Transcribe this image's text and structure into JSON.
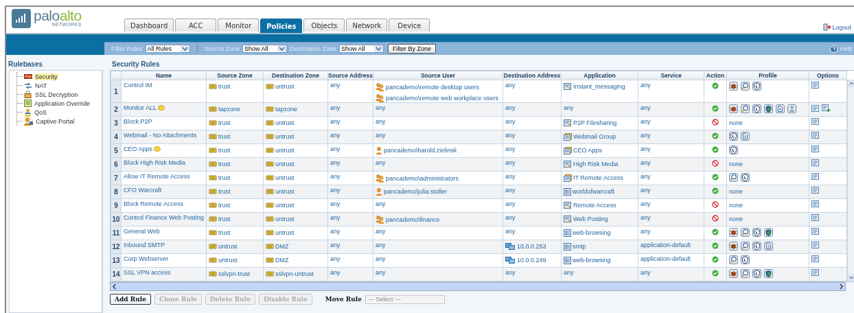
{
  "logo": {
    "name_parts": [
      "palo",
      "alto"
    ],
    "tagline": "NETWORKS"
  },
  "tabs": [
    {
      "label": "Dashboard",
      "selected": false
    },
    {
      "label": "ACC",
      "selected": false
    },
    {
      "label": "Monitor",
      "selected": false
    },
    {
      "label": "Policies",
      "selected": true
    },
    {
      "label": "Objects",
      "selected": false
    },
    {
      "label": "Network",
      "selected": false
    },
    {
      "label": "Device",
      "selected": false
    }
  ],
  "logout": "Logout",
  "filter_bar": {
    "filter_rules_label": "Filter Rules",
    "filter_rules_value": "All Rules",
    "source_zone_label": "Source Zone",
    "source_zone_value": "Show All",
    "destination_zone_label": "Destination Zone",
    "destination_zone_value": "Show All",
    "filter_button": "Filter By Zone",
    "help": "Help"
  },
  "sidebar": {
    "title": "Rulebases",
    "items": [
      {
        "label": "Security",
        "kind": "security",
        "selected": true
      },
      {
        "label": "NAT",
        "kind": "nat",
        "selected": false
      },
      {
        "label": "SSL Decryption",
        "kind": "ssl",
        "selected": false
      },
      {
        "label": "Application Override",
        "kind": "override",
        "selected": false
      },
      {
        "label": "QoS",
        "kind": "qos",
        "selected": false
      },
      {
        "label": "Captive Portal",
        "kind": "portal",
        "selected": false
      }
    ]
  },
  "table": {
    "title": "Security Rules",
    "columns": [
      "Name",
      "Source Zone",
      "Destination Zone",
      "Source Address",
      "Source User",
      "Destination Address",
      "Application",
      "Service",
      "Action",
      "Profile",
      "Options"
    ],
    "rows": [
      {
        "number": "1",
        "name": "Control IM",
        "note": false,
        "source_zone": "trust",
        "destination_zone": "untrust",
        "source_address": "any",
        "source_user": [
          {
            "text": "pancademo\\remote desktop users",
            "kind": "group"
          },
          {
            "text": "pancademo\\remote web workplace users",
            "kind": "group"
          }
        ],
        "destination_address": {
          "text": "any",
          "kind": "plain"
        },
        "application": {
          "text": "Instant_messaging",
          "kind": "filter"
        },
        "service": "any",
        "action": {
          "kind": "allow"
        },
        "profiles": [
          {
            "kind": "antivirus"
          },
          {
            "kind": "vulnerability"
          },
          {
            "kind": "spyware"
          }
        ],
        "options": [
          {
            "kind": "log"
          }
        ]
      },
      {
        "number": "2",
        "name": "Monitor ALL",
        "note": true,
        "source_zone": "tapzone",
        "destination_zone": "tapzone",
        "source_address": "any",
        "source_user": [
          {
            "text": "any",
            "kind": "plain"
          }
        ],
        "destination_address": {
          "text": "any",
          "kind": "plain"
        },
        "application": {
          "text": "any",
          "kind": "plain"
        },
        "service": "any",
        "action": {
          "kind": "allow"
        },
        "profiles": [
          {
            "kind": "antivirus"
          },
          {
            "kind": "vulnerability"
          },
          {
            "kind": "spyware"
          },
          {
            "kind": "url"
          },
          {
            "kind": "file"
          },
          {
            "kind": "data"
          }
        ],
        "options": [
          {
            "kind": "log"
          },
          {
            "kind": "schedule"
          }
        ]
      },
      {
        "number": "3",
        "name": "Block P2P",
        "note": false,
        "source_zone": "trust",
        "destination_zone": "untrust",
        "source_address": "any",
        "source_user": [
          {
            "text": "any",
            "kind": "plain"
          }
        ],
        "destination_address": {
          "text": "any",
          "kind": "plain"
        },
        "application": {
          "text": "P2P Filesharing",
          "kind": "filter"
        },
        "service": "any",
        "action": {
          "kind": "deny"
        },
        "profile_text": "none",
        "options": [
          {
            "kind": "log"
          }
        ]
      },
      {
        "number": "4",
        "name": "Webmail - No Attachments",
        "note": false,
        "source_zone": "trust",
        "destination_zone": "untrust",
        "source_address": "any",
        "source_user": [
          {
            "text": "any",
            "kind": "plain"
          }
        ],
        "destination_address": {
          "text": "any",
          "kind": "plain"
        },
        "application": {
          "text": "Webmail Group",
          "kind": "group"
        },
        "service": "any",
        "action": {
          "kind": "allow"
        },
        "profiles": [
          {
            "kind": "spyware"
          },
          {
            "kind": "file"
          }
        ],
        "options": [
          {
            "kind": "log"
          }
        ]
      },
      {
        "number": "5",
        "name": "CEO Apps",
        "note": true,
        "source_zone": "trust",
        "destination_zone": "untrust",
        "source_address": "any",
        "source_user": [
          {
            "text": "pancademo\\harold.zielinsk",
            "kind": "user"
          }
        ],
        "destination_address": {
          "text": "any",
          "kind": "plain"
        },
        "application": {
          "text": "CEO Apps",
          "kind": "group"
        },
        "service": "any",
        "action": {
          "kind": "allow"
        },
        "profiles": [
          {
            "kind": "spyware"
          }
        ],
        "options": [
          {
            "kind": "log"
          }
        ]
      },
      {
        "number": "6",
        "name": "Block High Risk Media",
        "note": false,
        "source_zone": "trust",
        "destination_zone": "untrust",
        "source_address": "any",
        "source_user": [
          {
            "text": "any",
            "kind": "plain"
          }
        ],
        "destination_address": {
          "text": "any",
          "kind": "plain"
        },
        "application": {
          "text": "High Risk Media",
          "kind": "filter"
        },
        "service": "any",
        "action": {
          "kind": "deny"
        },
        "profile_text": "none",
        "options": [
          {
            "kind": "log"
          }
        ]
      },
      {
        "number": "7",
        "name": "Allow IT Remote Access",
        "note": false,
        "source_zone": "trust",
        "destination_zone": "untrust",
        "source_address": "any",
        "source_user": [
          {
            "text": "pancademo\\administrators",
            "kind": "group"
          }
        ],
        "destination_address": {
          "text": "any",
          "kind": "plain"
        },
        "application": {
          "text": "IT Remote Access",
          "kind": "group"
        },
        "service": "any",
        "action": {
          "kind": "allow"
        },
        "profiles": [
          {
            "kind": "vulnerability"
          },
          {
            "kind": "spyware"
          }
        ],
        "options": [
          {
            "kind": "log"
          }
        ]
      },
      {
        "number": "8",
        "name": "CFO Warcraft",
        "note": false,
        "source_zone": "trust",
        "destination_zone": "untrust",
        "source_address": "any",
        "source_user": [
          {
            "text": "pancademo\\julia.stoller",
            "kind": "user"
          }
        ],
        "destination_address": {
          "text": "any",
          "kind": "plain"
        },
        "application": {
          "text": "worldofwarcraft",
          "kind": "app"
        },
        "service": "any",
        "action": {
          "kind": "allow"
        },
        "profile_text": "none",
        "options": [
          {
            "kind": "log"
          }
        ]
      },
      {
        "number": "9",
        "name": "Block Remote Access",
        "note": false,
        "source_zone": "trust",
        "destination_zone": "untrust",
        "source_address": "any",
        "source_user": [
          {
            "text": "any",
            "kind": "plain"
          }
        ],
        "destination_address": {
          "text": "any",
          "kind": "plain"
        },
        "application": {
          "text": "Remote Access",
          "kind": "filter"
        },
        "service": "any",
        "action": {
          "kind": "deny"
        },
        "profile_text": "none",
        "options": [
          {
            "kind": "log"
          }
        ]
      },
      {
        "number": "10",
        "name": "Control Finance Web Posting",
        "note": false,
        "source_zone": "trust",
        "destination_zone": "untrust",
        "source_address": "any",
        "source_user": [
          {
            "text": "pancademo\\finance",
            "kind": "group"
          }
        ],
        "destination_address": {
          "text": "any",
          "kind": "plain"
        },
        "application": {
          "text": "Web Posting",
          "kind": "filter"
        },
        "service": "any",
        "action": {
          "kind": "deny"
        },
        "profile_text": "none",
        "options": [
          {
            "kind": "log"
          }
        ]
      },
      {
        "number": "11",
        "name": "General Web",
        "note": false,
        "source_zone": "trust",
        "destination_zone": "untrust",
        "source_address": "any",
        "source_user": [
          {
            "text": "any",
            "kind": "plain"
          }
        ],
        "destination_address": {
          "text": "any",
          "kind": "plain"
        },
        "application": {
          "text": "web-browsing",
          "kind": "app"
        },
        "service": "any",
        "action": {
          "kind": "allow"
        },
        "profiles": [
          {
            "kind": "antivirus"
          },
          {
            "kind": "vulnerability"
          },
          {
            "kind": "spyware"
          },
          {
            "kind": "url"
          }
        ],
        "options": [
          {
            "kind": "log"
          }
        ]
      },
      {
        "number": "12",
        "name": "Inbound SMTP",
        "note": false,
        "source_zone": "untrust",
        "destination_zone": "DMZ",
        "source_address": "any",
        "source_user": [
          {
            "text": "any",
            "kind": "plain"
          }
        ],
        "destination_address": {
          "text": "10.0.0.253",
          "kind": "address"
        },
        "application": {
          "text": "smtp",
          "kind": "app"
        },
        "service": "application-default",
        "action": {
          "kind": "allow"
        },
        "profiles": [
          {
            "kind": "antivirus"
          },
          {
            "kind": "vulnerability"
          },
          {
            "kind": "spyware"
          },
          {
            "kind": "file"
          }
        ],
        "options": [
          {
            "kind": "log"
          }
        ]
      },
      {
        "number": "13",
        "name": "Corp Webserver",
        "note": false,
        "source_zone": "untrust",
        "destination_zone": "DMZ",
        "source_address": "any",
        "source_user": [
          {
            "text": "any",
            "kind": "plain"
          }
        ],
        "destination_address": {
          "text": "10.0.0.249",
          "kind": "address"
        },
        "application": {
          "text": "web-browsing",
          "kind": "app"
        },
        "service": "application-default",
        "action": {
          "kind": "allow"
        },
        "profiles": [
          {
            "kind": "vulnerability"
          },
          {
            "kind": "spyware"
          }
        ],
        "options": [
          {
            "kind": "log"
          }
        ]
      },
      {
        "number": "14",
        "name": "SSL VPN access",
        "note": false,
        "source_zone": "sslvpn-trust",
        "destination_zone": "sslvpn-untrust",
        "source_address": "any",
        "source_user": [
          {
            "text": "any",
            "kind": "plain"
          }
        ],
        "destination_address": {
          "text": "any",
          "kind": "plain"
        },
        "application": {
          "text": "any",
          "kind": "plain"
        },
        "service": "any",
        "action": {
          "kind": "allow"
        },
        "profiles": [
          {
            "kind": "antivirus"
          },
          {
            "kind": "vulnerability"
          },
          {
            "kind": "spyware"
          },
          {
            "kind": "url"
          }
        ],
        "options": [
          {
            "kind": "log"
          }
        ]
      }
    ]
  },
  "actions": {
    "buttons": [
      {
        "label": "Add Rule",
        "disabled": false
      },
      {
        "label": "Clone Rule",
        "disabled": true
      },
      {
        "label": "Delete Rule",
        "disabled": true
      },
      {
        "label": "Disable Rule",
        "disabled": true
      }
    ],
    "move_label": "Move Rule",
    "move_placeholder": "--- Select ---"
  }
}
